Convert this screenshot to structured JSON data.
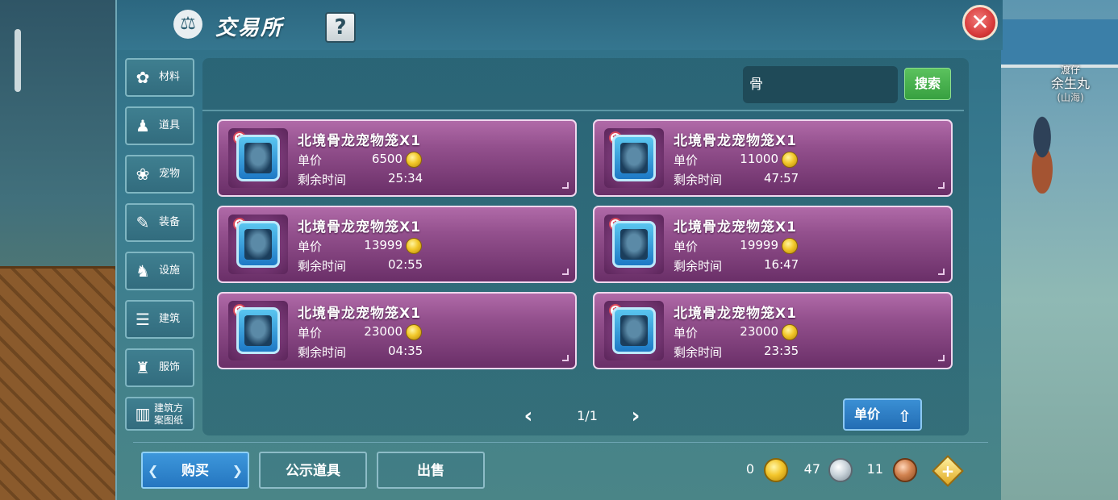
{
  "title": "交易所",
  "help_label": "?",
  "close_label": "✕",
  "npc": {
    "tag_top": "渡仔",
    "name": "余生丸",
    "sub": "(山海)"
  },
  "categories": [
    {
      "label": "材料",
      "icon": "materials-icon",
      "glyph": "✿"
    },
    {
      "label": "道具",
      "icon": "tool-icon",
      "glyph": "♟"
    },
    {
      "label": "宠物",
      "icon": "paw-icon",
      "glyph": "❀"
    },
    {
      "label": "装备",
      "icon": "equipment-icon",
      "glyph": "✎"
    },
    {
      "label": "设施",
      "icon": "facility-icon",
      "glyph": "♞"
    },
    {
      "label": "建筑",
      "icon": "building-icon",
      "glyph": "☰"
    },
    {
      "label": "服饰",
      "icon": "clothing-icon",
      "glyph": "♜"
    },
    {
      "label": "建筑方案图纸",
      "label_line1": "建筑方",
      "label_line2": "案图纸",
      "icon": "blueprint-icon",
      "glyph": "▥"
    }
  ],
  "search": {
    "value": "骨",
    "button_label": "搜索"
  },
  "listing": {
    "price_label": "单价",
    "time_label": "剩余时间",
    "items": [
      {
        "name": "北境骨龙宠物笼X1",
        "price": "6500",
        "time": "25:34"
      },
      {
        "name": "北境骨龙宠物笼X1",
        "price": "11000",
        "time": "47:57"
      },
      {
        "name": "北境骨龙宠物笼X1",
        "price": "13999",
        "time": "02:55"
      },
      {
        "name": "北境骨龙宠物笼X1",
        "price": "19999",
        "time": "16:47"
      },
      {
        "name": "北境骨龙宠物笼X1",
        "price": "23000",
        "time": "04:35"
      },
      {
        "name": "北境骨龙宠物笼X1",
        "price": "23000",
        "time": "23:35"
      }
    ]
  },
  "pagination": {
    "text": "1/1",
    "prev": "‹",
    "next": "›"
  },
  "sort": {
    "label": "单价",
    "arrow": "⇧"
  },
  "tabs": {
    "buy": "购买",
    "public": "公示道具",
    "sell": "出售"
  },
  "currency": {
    "gold": "0",
    "silver": "47",
    "copper": "11",
    "add": "+"
  },
  "colors": {
    "accent_green": "#37a040",
    "accent_blue": "#2576c0",
    "item_purple": "#93508d",
    "close_red": "#d83b3b"
  }
}
